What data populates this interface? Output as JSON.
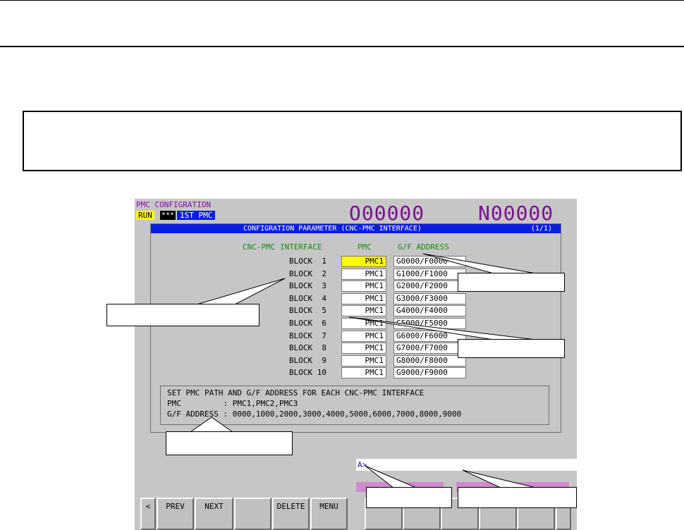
{
  "screen": {
    "title": "PMC CONFIGRATION",
    "status_run": "RUN",
    "status_stars": "***",
    "pmc_selected": "1ST PMC",
    "program_number": "O00000",
    "sequence_number": "N00000",
    "header_bar": {
      "title": "CONFIGRATION PARAMETER (CNC-PMC INTERFACE)",
      "page": "(1/1)"
    },
    "columns": {
      "interface": "CNC-PMC INTERFACE",
      "pmc": "PMC",
      "address": "G/F ADDRESS"
    },
    "rows": [
      {
        "block": "BLOCK  1",
        "pmc": "PMC1",
        "address": "G0000/F0000"
      },
      {
        "block": "BLOCK  2",
        "pmc": "PMC1",
        "address": "G1000/F1000"
      },
      {
        "block": "BLOCK  3",
        "pmc": "PMC1",
        "address": "G2000/F2000"
      },
      {
        "block": "BLOCK  4",
        "pmc": "PMC1",
        "address": "G3000/F3000"
      },
      {
        "block": "BLOCK  5",
        "pmc": "PMC1",
        "address": "G4000/F4000"
      },
      {
        "block": "BLOCK  6",
        "pmc": "PMC1",
        "address": "G5000/F5000"
      },
      {
        "block": "BLOCK  7",
        "pmc": "PMC1",
        "address": "G6000/F6000"
      },
      {
        "block": "BLOCK  8",
        "pmc": "PMC1",
        "address": "G7000/F7000"
      },
      {
        "block": "BLOCK  9",
        "pmc": "PMC1",
        "address": "G8000/F8000"
      },
      {
        "block": "BLOCK 10",
        "pmc": "PMC1",
        "address": "G9000/F9000"
      }
    ],
    "info": {
      "line1": "SET PMC PATH AND G/F ADDRESS FOR EACH CNC-PMC INTERFACE",
      "line2": "PMC         : PMC1,PMC2,PMC3",
      "line3": "G/F ADDRESS : 0000,1000,2000,3000,4000,5000,6000,7000,8000,9000"
    },
    "input_prompt": "A>",
    "softkeys": {
      "left_arrow": "<",
      "prev": "PREV",
      "next": "NEXT",
      "blank": "",
      "delete": "DELETE",
      "menu": "MENU"
    }
  },
  "colors": {
    "screen_bg": "#c6c6c6",
    "title_bar_blue": "#0a1ee0",
    "selected_yellow": "#ffff00",
    "header_green": "#1a8a1a",
    "number_purple": "#7a0e8f"
  }
}
